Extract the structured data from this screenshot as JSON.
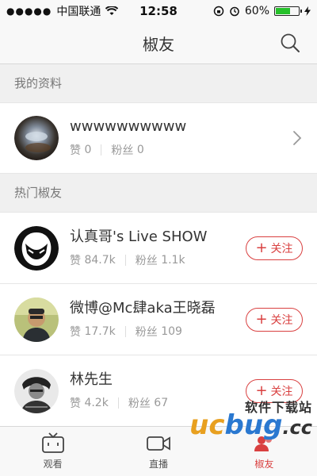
{
  "status_bar": {
    "carrier": "中国联通",
    "time": "12:58",
    "battery": "60%",
    "battery_level": 0.6
  },
  "nav": {
    "title": "椒友",
    "icon": "search-icon"
  },
  "my_profile": {
    "section_title": "我的资料",
    "name": "wwwwwwwwww",
    "likes_label": "赞",
    "likes": "0",
    "fans_label": "粉丝",
    "fans": "0"
  },
  "hot": {
    "section_title": "热门椒友",
    "follow_label": "关注",
    "users": [
      {
        "name": "认真哥's Live SHOW",
        "likes_label": "赞",
        "likes": "84.7k",
        "fans_label": "粉丝",
        "fans": "1.1k"
      },
      {
        "name": "微博@Mc肆aka王晓磊",
        "likes_label": "赞",
        "likes": "17.7k",
        "fans_label": "粉丝",
        "fans": "109"
      },
      {
        "name": "林先生",
        "likes_label": "赞",
        "likes": "4.2k",
        "fans_label": "粉丝",
        "fans": "67"
      }
    ]
  },
  "tabs": [
    {
      "label": "观看",
      "icon": "tv-icon"
    },
    {
      "label": "直播",
      "icon": "video-camera-icon"
    },
    {
      "label": "椒友",
      "icon": "friends-icon"
    }
  ],
  "watermark": {
    "top": "软件下载站",
    "logo": "ucbug.cc"
  },
  "colors": {
    "accent": "#d94040",
    "battery": "#26c12a"
  }
}
